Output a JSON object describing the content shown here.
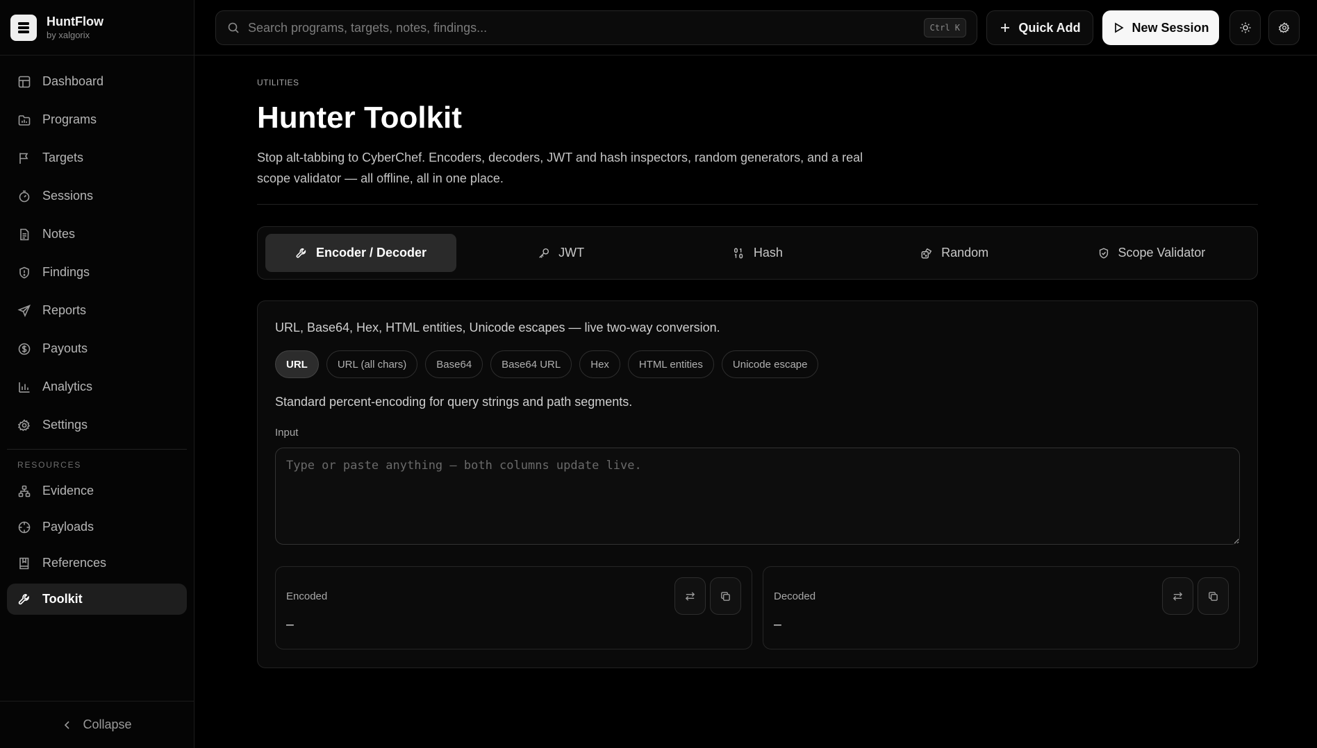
{
  "app": {
    "name": "HuntFlow",
    "byline": "by xalgorix"
  },
  "sidebar": {
    "items": [
      {
        "label": "Dashboard",
        "icon": "grid-icon"
      },
      {
        "label": "Programs",
        "icon": "folder-chart-icon"
      },
      {
        "label": "Targets",
        "icon": "flag-icon"
      },
      {
        "label": "Sessions",
        "icon": "timer-icon"
      },
      {
        "label": "Notes",
        "icon": "note-icon"
      },
      {
        "label": "Findings",
        "icon": "shield-alert-icon"
      },
      {
        "label": "Reports",
        "icon": "send-icon"
      },
      {
        "label": "Payouts",
        "icon": "dollar-circle-icon"
      },
      {
        "label": "Analytics",
        "icon": "bar-chart-icon"
      },
      {
        "label": "Settings",
        "icon": "gear-icon"
      }
    ],
    "resources_label": "RESOURCES",
    "resources": [
      {
        "label": "Evidence",
        "icon": "network-icon"
      },
      {
        "label": "Payloads",
        "icon": "crosshair-icon"
      },
      {
        "label": "References",
        "icon": "book-icon"
      },
      {
        "label": "Toolkit",
        "icon": "wrench-icon",
        "active": true
      }
    ],
    "collapse_label": "Collapse"
  },
  "topbar": {
    "search_placeholder": "Search programs, targets, notes, findings...",
    "shortcut": "Ctrl K",
    "quick_add_label": "Quick Add",
    "new_session_label": "New Session"
  },
  "page": {
    "breadcrumb": "UTILITIES",
    "title": "Hunter Toolkit",
    "description": "Stop alt-tabbing to CyberChef. Encoders, decoders, JWT and hash inspectors, random generators, and a real scope validator — all offline, all in one place."
  },
  "tabs": [
    {
      "label": "Encoder / Decoder",
      "icon": "wrench-icon",
      "active": true
    },
    {
      "label": "JWT",
      "icon": "key-icon"
    },
    {
      "label": "Hash",
      "icon": "binary-icon"
    },
    {
      "label": "Random",
      "icon": "dice-icon"
    },
    {
      "label": "Scope Validator",
      "icon": "shield-check-icon"
    }
  ],
  "encoder": {
    "subtitle": "URL, Base64, Hex, HTML entities, Unicode escapes — live two-way conversion.",
    "modes": [
      "URL",
      "URL (all chars)",
      "Base64",
      "Base64 URL",
      "Hex",
      "HTML entities",
      "Unicode escape"
    ],
    "active_mode": "URL",
    "mode_description": "Standard percent-encoding for query strings and path segments.",
    "input_label": "Input",
    "input_placeholder": "Type or paste anything — both columns update live.",
    "input_value": "",
    "encoded_label": "Encoded",
    "encoded_value": "–",
    "decoded_label": "Decoded",
    "decoded_value": "–"
  }
}
